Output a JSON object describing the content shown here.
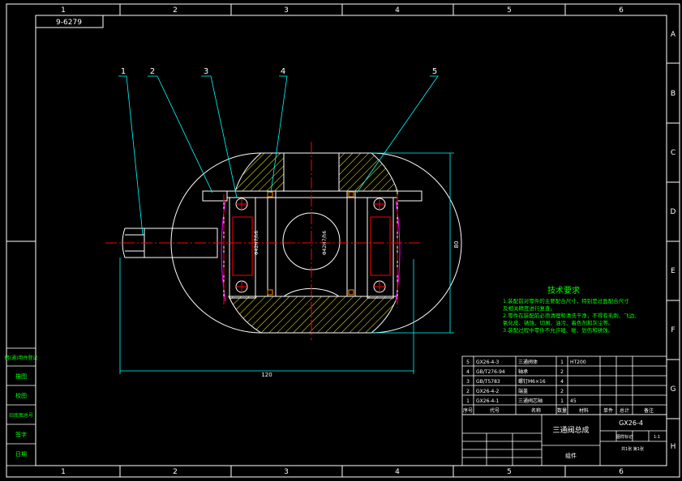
{
  "drawing": {
    "title_tag": "9-6279",
    "col_labels": [
      "1",
      "2",
      "3",
      "4",
      "5",
      "6"
    ],
    "row_labels": [
      "A",
      "B",
      "C",
      "D",
      "E",
      "F",
      "G",
      "H"
    ],
    "callouts": [
      "1",
      "2",
      "3",
      "4",
      "5"
    ],
    "dims": {
      "height": "80",
      "width": "120",
      "fit_left": "Φ42H7/h6",
      "fit_right": "Φ42H7/h6"
    }
  },
  "tech_req": {
    "title": "技术要求",
    "lines": [
      "1.装配前对零件的主要配合尺寸，特别是过盈配合尺寸",
      "  及相关精度进行复查。",
      "2.零件在装配前必须清理和清洗干净，不得有毛刺、飞边、",
      "  氧化皮、锈蚀、切屑、油污、着色剂和灰尘等。",
      "3.装配过程中零件不允许磕、碰、划伤和锈蚀。"
    ]
  },
  "bom": {
    "rows": [
      {
        "no": "5",
        "code": "GX26-4-3",
        "name": "三通阀体",
        "qty": "1",
        "mat": "HT200",
        "note": ""
      },
      {
        "no": "4",
        "code": "GB/T276-94",
        "name": "轴承",
        "qty": "2",
        "mat": "",
        "note": ""
      },
      {
        "no": "3",
        "code": "GB/T5783",
        "name": "螺钉M6×16",
        "qty": "4",
        "mat": "",
        "note": ""
      },
      {
        "no": "2",
        "code": "GX26-4-2",
        "name": "端盖",
        "qty": "2",
        "mat": "",
        "note": ""
      },
      {
        "no": "1",
        "code": "GX26-4-1",
        "name": "三通阀芯轴",
        "qty": "1",
        "mat": "45",
        "note": ""
      }
    ],
    "headers": [
      "序号",
      "代号",
      "名称",
      "数量",
      "材料",
      "单件",
      "总计",
      "备注"
    ]
  },
  "title_block": {
    "drawing_no": "GX26-4",
    "name": "三通阀总成",
    "unit": "组件",
    "scale_hdr": [
      "图样标记",
      "重量",
      "比例"
    ],
    "scale": "1:1",
    "sheet": "共1张 第1张"
  },
  "side_stamps": [
    "借(通)用件登记",
    "描图",
    "校图",
    "旧底图总号",
    "签字",
    "日期"
  ]
}
